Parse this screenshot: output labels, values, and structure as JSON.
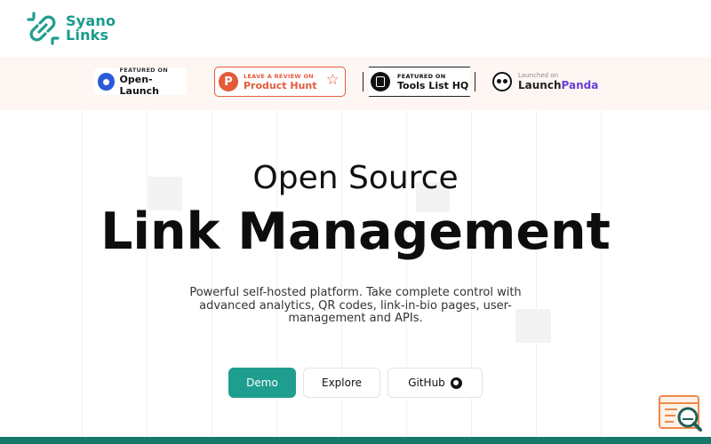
{
  "header": {
    "logo_line1": "Syano",
    "logo_line2": "Links",
    "logo_icon": "chain-link-icon"
  },
  "badges": {
    "open_launch": {
      "small": "FEATURED ON",
      "big": "Open-Launch"
    },
    "product_hunt": {
      "small": "LEAVE A REVIEW ON",
      "big": "Product Hunt",
      "letter": "P"
    },
    "tools_list": {
      "small": "FEATURED ON",
      "big": "Tools List HQ"
    },
    "launch_panda": {
      "small": "Launched on",
      "big_part1": "Launch",
      "big_part2": "Panda"
    }
  },
  "hero": {
    "subtitle": "Open Source",
    "title": "Link Management",
    "description": "Powerful self-hosted platform. Take complete control with advanced analytics, QR codes, link-in-bio pages, user-management and APIs."
  },
  "buttons": {
    "demo": "Demo",
    "explore": "Explore",
    "github": "GitHub"
  },
  "colors": {
    "brand_teal": "#1f9e8f",
    "product_hunt_orange": "#e45a3b",
    "panda_purple": "#6b3fd8",
    "bottom_bar": "#17786c"
  }
}
